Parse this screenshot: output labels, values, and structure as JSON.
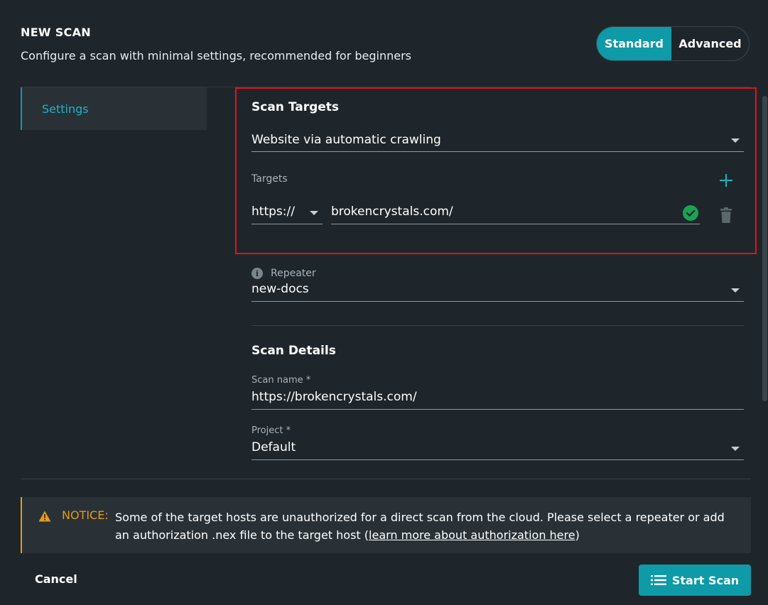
{
  "header": {
    "title": "NEW SCAN",
    "subtitle": "Configure a scan with minimal settings, recommended for beginners",
    "modes": {
      "standard": "Standard",
      "advanced": "Advanced",
      "selected": "Standard"
    }
  },
  "sidebar": {
    "items": [
      {
        "label": "Settings",
        "active": true
      }
    ]
  },
  "scan_targets": {
    "title": "Scan Targets",
    "target_type": "Website via automatic crawling",
    "targets_label": "Targets",
    "protocol": "https://",
    "host": "brokencrystals.com/"
  },
  "repeater": {
    "label": "Repeater",
    "value": "new-docs"
  },
  "scan_details": {
    "title": "Scan Details",
    "scan_name_label": "Scan name *",
    "scan_name_value": "https://brokencrystals.com/",
    "project_label": "Project *",
    "project_value": "Default"
  },
  "notice": {
    "label": "NOTICE:",
    "text": "Some of the target hosts are unauthorized for a direct scan from the cloud. Please select a repeater or add an authorization .nex file to the target host (",
    "link": "learn more about authorization here",
    "text_end": ")"
  },
  "footer": {
    "cancel_label": "Cancel",
    "start_label": "Start Scan"
  },
  "colors": {
    "accent": "#0e9aa7",
    "warning": "#e59b1b",
    "success": "#1aa354",
    "highlight": "#e0141a",
    "background": "#1f262b"
  }
}
